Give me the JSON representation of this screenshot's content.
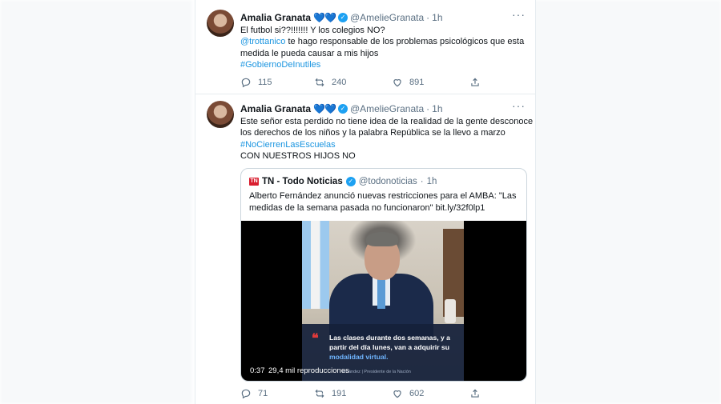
{
  "tweets": [
    {
      "author": {
        "name": "Amalia Granata",
        "emoji": "💙💙",
        "handle": "@AmelieGranata"
      },
      "dot": "·",
      "time": "1h",
      "more": "···",
      "lines": [
        {
          "text": "El futbol si??!!!!!!! Y los colegios NO?"
        },
        {
          "mention": "@trottanico",
          "text": " te hago responsable de los problemas psicológicos que esta"
        },
        {
          "text": "medida le pueda causar a mis hijos"
        },
        {
          "hashtag": "#GobiernoDeInutiles"
        }
      ],
      "actions": {
        "replies": "115",
        "retweets": "240",
        "likes": "891"
      }
    },
    {
      "author": {
        "name": "Amalia Granata",
        "emoji": "💙💙",
        "handle": "@AmelieGranata"
      },
      "dot": "·",
      "time": "1h",
      "more": "···",
      "lines": [
        {
          "text": "Este señor esta perdido no tiene idea de la realidad de la gente desconoce"
        },
        {
          "text": "los derechos de los niños y la palabra República se la llevo a marzo"
        },
        {
          "hashtag": "#NoCierrenLasEscuelas"
        },
        {
          "text": "CON NUESTROS HIJOS NO"
        }
      ],
      "quote": {
        "logo": "TN",
        "name": "TN - Todo Noticias",
        "handle": "@todonoticias",
        "dot": "·",
        "time": "1h",
        "lines": [
          "Alberto Fernández anunció nuevas restricciones para el AMBA: \"Las",
          "medidas de la semana pasada no funcionaron\"  bit.ly/32f0lp1"
        ],
        "video": {
          "caption_lines": [
            "Las clases durante dos semanas, y a",
            "partir del día lunes, van a adquirir su"
          ],
          "caption_highlight": "modalidad virtual.",
          "credit": "ernández | Presidente de la Nación",
          "duration": "0:37",
          "views": "29,4 mil reproducciones"
        }
      },
      "actions": {
        "replies": "71",
        "retweets": "191",
        "likes": "602"
      }
    }
  ],
  "colors": {
    "accent": "#1da1f2",
    "link": "#1b95e0",
    "muted": "#5b7083"
  },
  "icons": [
    "reply-icon",
    "retweet-icon",
    "like-icon",
    "share-icon",
    "verified-icon",
    "more-icon"
  ]
}
